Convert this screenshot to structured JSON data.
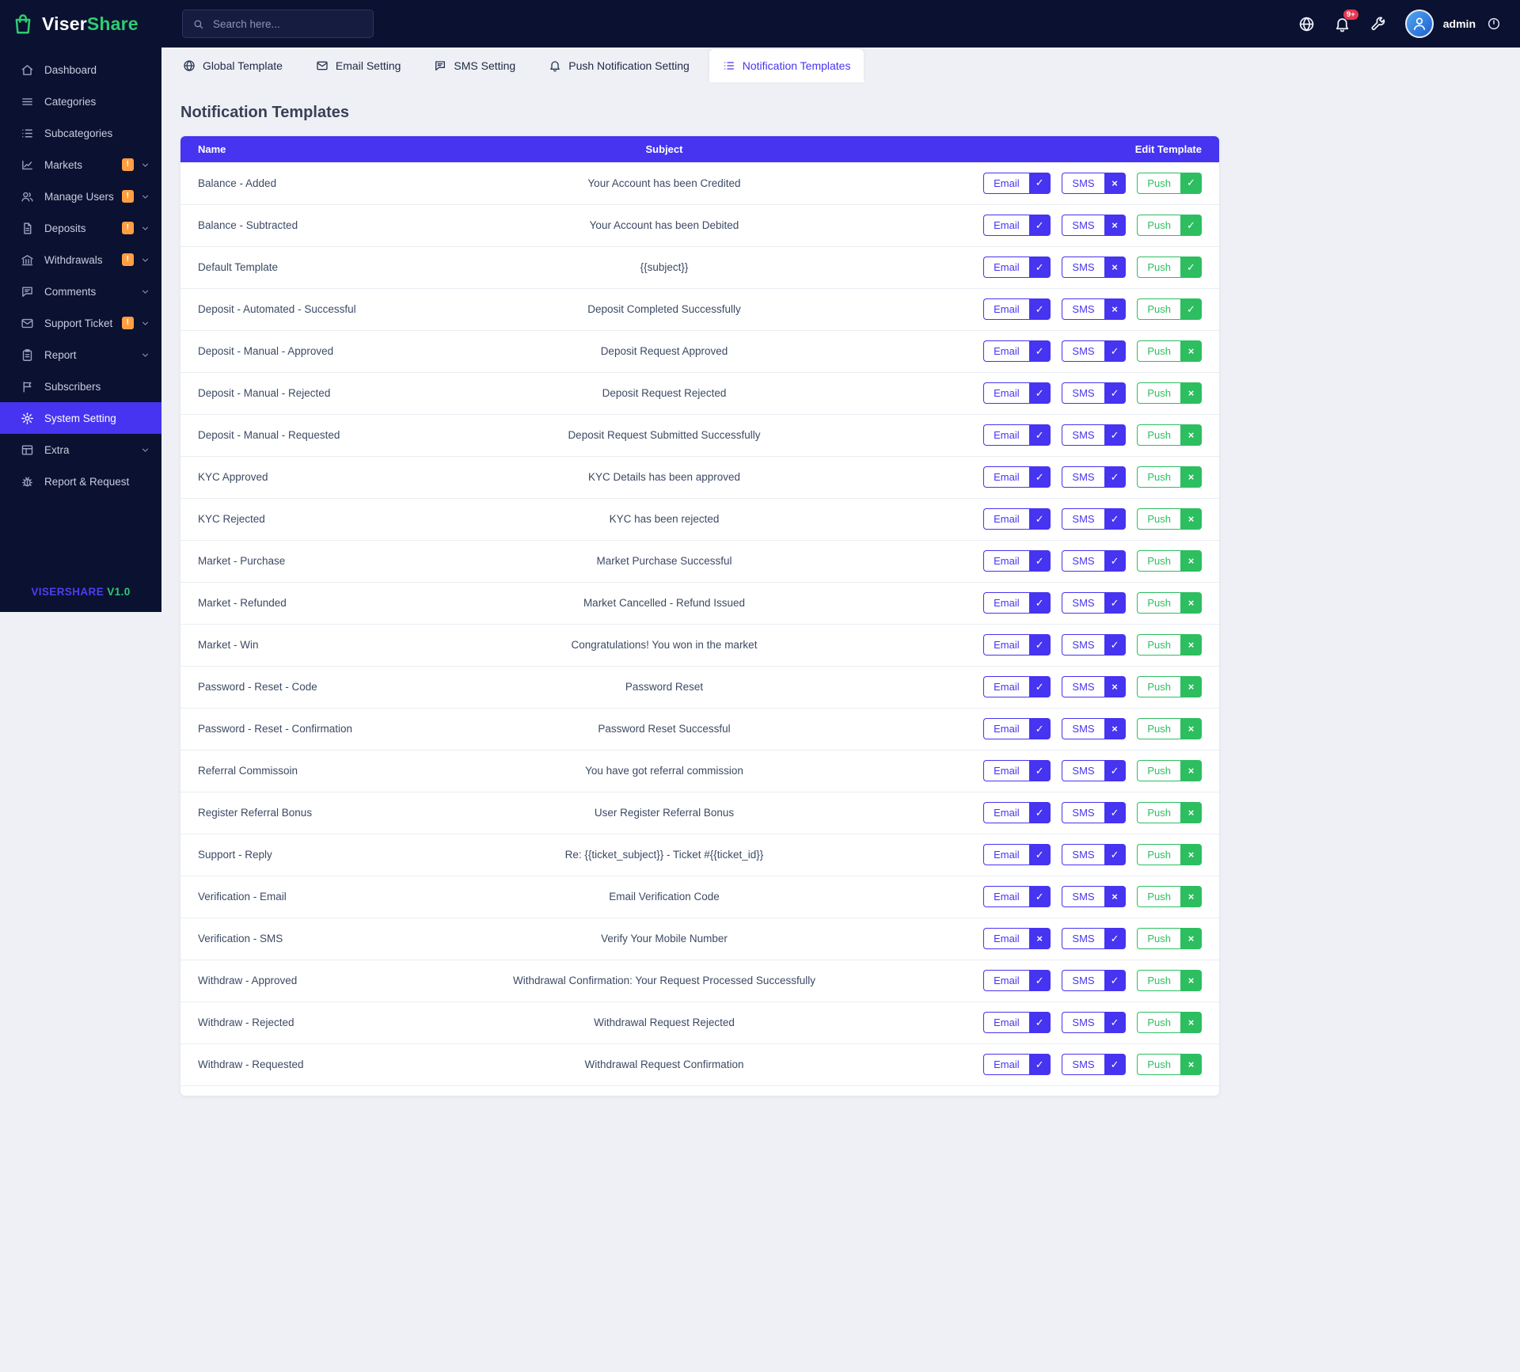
{
  "brand": {
    "name_primary": "Viser",
    "name_secondary": "Share",
    "logo_icon": "shopping-bag-icon",
    "version_label": "VISERSHARE",
    "version_number": "V1.0"
  },
  "header": {
    "search_placeholder": "Search here...",
    "notification_count": "9+",
    "user_name": "admin",
    "icon_names": [
      "search-icon",
      "globe-icon",
      "bell-icon",
      "wrench-icon",
      "avatar-user-icon",
      "power-icon"
    ]
  },
  "sidebar": {
    "items": [
      {
        "label": "Dashboard",
        "icon": "home-icon"
      },
      {
        "label": "Categories",
        "icon": "menu-icon"
      },
      {
        "label": "Subcategories",
        "icon": "list-icon"
      },
      {
        "label": "Markets",
        "icon": "chart-icon",
        "badge": "!",
        "chevron": true
      },
      {
        "label": "Manage Users",
        "icon": "users-icon",
        "badge": "!",
        "chevron": true
      },
      {
        "label": "Deposits",
        "icon": "file-icon",
        "badge": "!",
        "chevron": true
      },
      {
        "label": "Withdrawals",
        "icon": "bank-icon",
        "badge": "!",
        "chevron": true
      },
      {
        "label": "Comments",
        "icon": "chat-icon",
        "chevron": true
      },
      {
        "label": "Support Ticket",
        "icon": "mail-icon",
        "badge": "!",
        "chevron": true
      },
      {
        "label": "Report",
        "icon": "clipboard-icon",
        "chevron": true
      },
      {
        "label": "Subscribers",
        "icon": "flag-icon"
      },
      {
        "label": "System Setting",
        "icon": "gear-icon",
        "active": true
      },
      {
        "label": "Extra",
        "icon": "grid-icon",
        "chevron": true
      },
      {
        "label": "Report & Request",
        "icon": "bug-icon"
      }
    ]
  },
  "tabs": [
    {
      "label": "Global Template",
      "icon": "globe-icon"
    },
    {
      "label": "Email Setting",
      "icon": "mail-icon"
    },
    {
      "label": "SMS Setting",
      "icon": "chat-icon"
    },
    {
      "label": "Push Notification Setting",
      "icon": "bell-icon"
    },
    {
      "label": "Notification Templates",
      "icon": "list-icon",
      "active": true
    }
  ],
  "page": {
    "title": "Notification Templates"
  },
  "table": {
    "columns": [
      "Name",
      "Subject",
      "Edit Template"
    ],
    "buttons": {
      "email": "Email",
      "sms": "SMS",
      "push": "Push"
    },
    "rows": [
      {
        "name": "Balance - Added",
        "subject": "Your Account has been Credited",
        "email_on": true,
        "sms_on": false,
        "push_on": true
      },
      {
        "name": "Balance - Subtracted",
        "subject": "Your Account has been Debited",
        "email_on": true,
        "sms_on": false,
        "push_on": true
      },
      {
        "name": "Default Template",
        "subject": "{{subject}}",
        "email_on": true,
        "sms_on": false,
        "push_on": true
      },
      {
        "name": "Deposit - Automated - Successful",
        "subject": "Deposit Completed Successfully",
        "email_on": true,
        "sms_on": false,
        "push_on": true
      },
      {
        "name": "Deposit - Manual - Approved",
        "subject": "Deposit Request Approved",
        "email_on": true,
        "sms_on": true,
        "push_on": false
      },
      {
        "name": "Deposit - Manual - Rejected",
        "subject": "Deposit Request Rejected",
        "email_on": true,
        "sms_on": true,
        "push_on": false
      },
      {
        "name": "Deposit - Manual - Requested",
        "subject": "Deposit Request Submitted Successfully",
        "email_on": true,
        "sms_on": true,
        "push_on": false
      },
      {
        "name": "KYC Approved",
        "subject": "KYC Details has been approved",
        "email_on": true,
        "sms_on": true,
        "push_on": false
      },
      {
        "name": "KYC Rejected",
        "subject": "KYC has been rejected",
        "email_on": true,
        "sms_on": true,
        "push_on": false
      },
      {
        "name": "Market - Purchase",
        "subject": "Market Purchase Successful",
        "email_on": true,
        "sms_on": true,
        "push_on": false
      },
      {
        "name": "Market - Refunded",
        "subject": "Market Cancelled - Refund Issued",
        "email_on": true,
        "sms_on": true,
        "push_on": false
      },
      {
        "name": "Market - Win",
        "subject": "Congratulations! You won in the market",
        "email_on": true,
        "sms_on": true,
        "push_on": false
      },
      {
        "name": "Password - Reset - Code",
        "subject": "Password Reset",
        "email_on": true,
        "sms_on": false,
        "push_on": false
      },
      {
        "name": "Password - Reset - Confirmation",
        "subject": "Password Reset Successful",
        "email_on": true,
        "sms_on": false,
        "push_on": false
      },
      {
        "name": "Referral Commissoin",
        "subject": "You have got referral commission",
        "email_on": true,
        "sms_on": true,
        "push_on": false
      },
      {
        "name": "Register Referral Bonus",
        "subject": "User Register Referral Bonus",
        "email_on": true,
        "sms_on": true,
        "push_on": false
      },
      {
        "name": "Support - Reply",
        "subject": "Re: {{ticket_subject}} - Ticket #{{ticket_id}}",
        "email_on": true,
        "sms_on": true,
        "push_on": false
      },
      {
        "name": "Verification - Email",
        "subject": "Email Verification Code",
        "email_on": true,
        "sms_on": false,
        "push_on": false
      },
      {
        "name": "Verification - SMS",
        "subject": "Verify Your Mobile Number",
        "email_on": false,
        "sms_on": true,
        "push_on": false
      },
      {
        "name": "Withdraw - Approved",
        "subject": "Withdrawal Confirmation: Your Request Processed Successfully",
        "email_on": true,
        "sms_on": true,
        "push_on": false
      },
      {
        "name": "Withdraw - Rejected",
        "subject": "Withdrawal Request Rejected",
        "email_on": true,
        "sms_on": true,
        "push_on": false
      },
      {
        "name": "Withdraw - Requested",
        "subject": "Withdrawal Request Confirmation",
        "email_on": true,
        "sms_on": true,
        "push_on": false
      }
    ]
  },
  "colors": {
    "accent": "#4634f0",
    "success": "#2dbe60",
    "brand_green": "#2ecc71",
    "warning_badge": "#ff9f43",
    "danger_badge": "#e8384f",
    "topbar_bg": "#0b1130",
    "page_bg": "#eef0f5"
  },
  "toggle_glyphs": {
    "on": "✓",
    "off": "×"
  }
}
